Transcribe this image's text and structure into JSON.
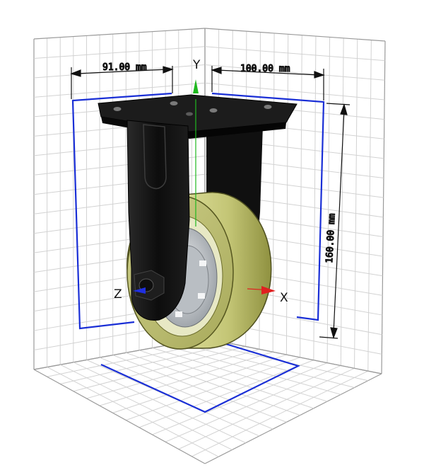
{
  "viewer": {
    "dimensions": {
      "width_label": "91.00 mm",
      "depth_label": "100.00 mm",
      "height_label": "160.00 mm"
    },
    "axes": {
      "y_label": "Y",
      "x_label": "X",
      "z_label": "Z"
    },
    "colors": {
      "grid_line": "#d2d2d2",
      "grid_edge": "#9a9a9a",
      "bounding_box": "#1a2fd6",
      "dimension_line": "#111111",
      "axis_x": "#e02020",
      "axis_y": "#1fb81f",
      "axis_z": "#2030e0",
      "wheel_tread": "#c7c97a",
      "wheel_hub": "#cfd3d6",
      "bracket": "#141414"
    }
  }
}
